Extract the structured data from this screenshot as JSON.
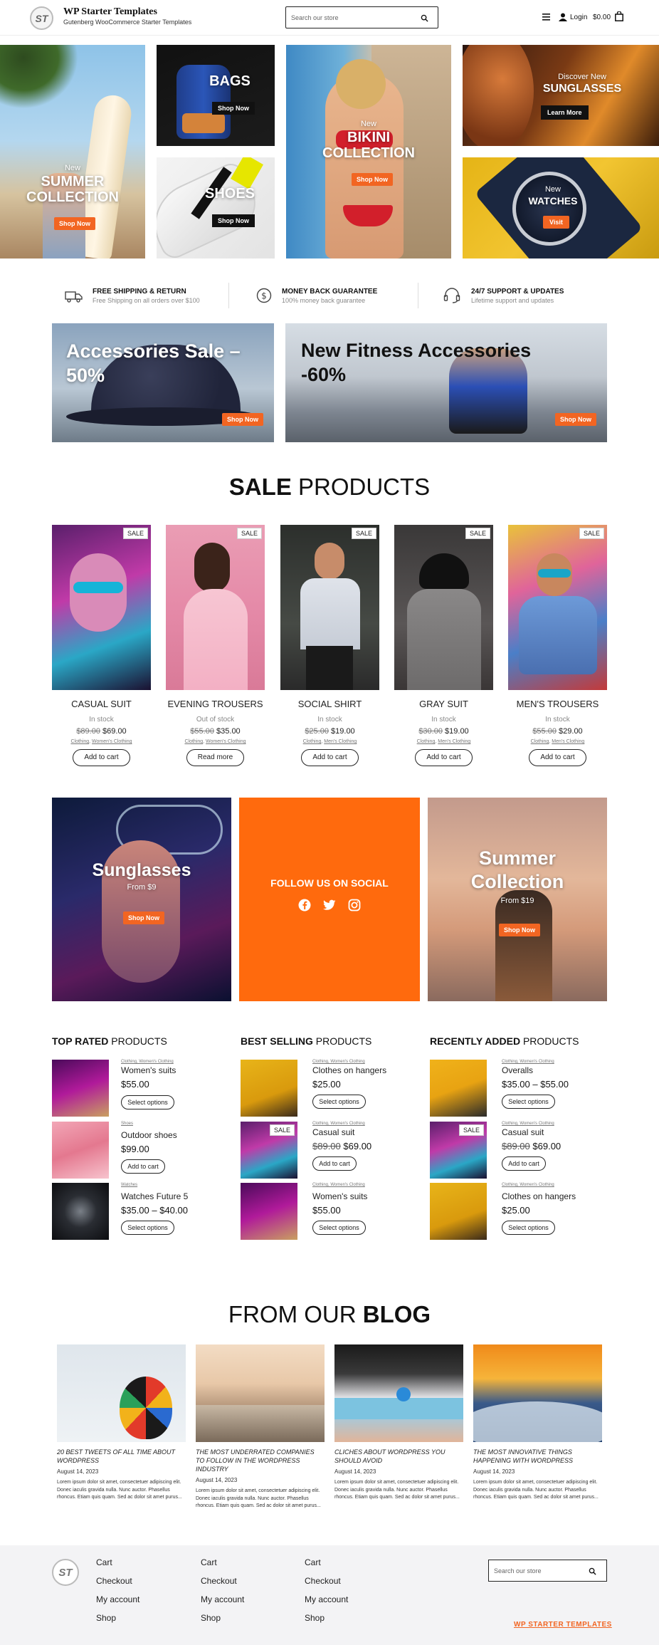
{
  "header": {
    "site_title": "WP Starter Templates",
    "site_tagline": "Gutenberg WooCommerce Starter Templates",
    "logo_text": "ST",
    "search_placeholder": "Search our store",
    "login_label": "Login",
    "cart_total": "$0.00"
  },
  "hero": {
    "summer": {
      "kicker": "New",
      "title1": "SUMMER",
      "title2": "COLLECTION",
      "cta": "Shop Now"
    },
    "bags": {
      "title": "BAGS",
      "cta": "Shop Now"
    },
    "shoes": {
      "title": "SHOES",
      "cta": "Shop Now"
    },
    "bikini": {
      "kicker": "New",
      "title1": "BIKINI",
      "title2": "COLLECTION",
      "cta": "Shop Now"
    },
    "sunglasses": {
      "kicker": "Discover New",
      "title": "SUNGLASSES",
      "cta": "Learn More"
    },
    "watches": {
      "kicker": "New",
      "title": "WATCHES",
      "cta": "Visit"
    }
  },
  "features": [
    {
      "title": "FREE SHIPPING & RETURN",
      "subtitle": "Free Shipping on all orders over $100",
      "icon": "truck-icon"
    },
    {
      "title": "MONEY BACK GUARANTEE",
      "subtitle": "100% money back guarantee",
      "icon": "dollar-icon"
    },
    {
      "title": "24/7 SUPPORT & UPDATES",
      "subtitle": "Lifetime support and updates",
      "icon": "support-icon"
    }
  ],
  "promo": {
    "accessories": {
      "title1": "Accessories Sale –",
      "title2": "50%",
      "cta": "Shop Now"
    },
    "fitness": {
      "title1": "New Fitness Accessories",
      "title2": "-60%",
      "cta": "Shop Now"
    }
  },
  "sale_section": {
    "title_bold": "SALE",
    "title_light": "PRODUCTS",
    "badge": "SALE",
    "products": [
      {
        "name": "CASUAL SUIT",
        "stock": "In stock",
        "old_price": "$89.00",
        "price": "$69.00",
        "cat1": "Clothing",
        "cat2": "Women's Clothing",
        "action": "Add to cart"
      },
      {
        "name": "EVENING TROUSERS",
        "stock": "Out of stock",
        "old_price": "$55.00",
        "price": "$35.00",
        "cat1": "Clothing",
        "cat2": "Women's Clothing",
        "action": "Read more"
      },
      {
        "name": "SOCIAL SHIRT",
        "stock": "In stock",
        "old_price": "$25.00",
        "price": "$19.00",
        "cat1": "Clothing",
        "cat2": "Men's Clothing",
        "action": "Add to cart"
      },
      {
        "name": "GRAY SUIT",
        "stock": "In stock",
        "old_price": "$30.00",
        "price": "$19.00",
        "cat1": "Clothing",
        "cat2": "Men's Clothing",
        "action": "Add to cart"
      },
      {
        "name": "MEN'S TROUSERS",
        "stock": "In stock",
        "old_price": "$55.00",
        "price": "$29.00",
        "cat1": "Clothing",
        "cat2": "Men's Clothing",
        "action": "Add to cart"
      }
    ]
  },
  "banners": {
    "sunglasses": {
      "title": "Sunglasses",
      "subtitle": "From $9",
      "cta": "Shop Now"
    },
    "social": {
      "title": "FOLLOW US ON SOCIAL"
    },
    "summer": {
      "title1": "Summer",
      "title2": "Collection",
      "subtitle": "From $19",
      "cta": "Shop Now"
    }
  },
  "product_lists": [
    {
      "title_bold": "TOP RATED",
      "title_light": "PRODUCTS",
      "items": [
        {
          "cats": "Clothing, Women's Clothing",
          "name": "Women's suits",
          "price": "$55.00",
          "old_price": "",
          "action": "Select options",
          "sale": false
        },
        {
          "cats": "Shoes",
          "name": "Outdoor shoes",
          "price": "$99.00",
          "old_price": "",
          "action": "Add to cart",
          "sale": false
        },
        {
          "cats": "Watches",
          "name": "Watches Future 5",
          "price": "$35.00 – $40.00",
          "old_price": "",
          "action": "Select options",
          "sale": false
        }
      ]
    },
    {
      "title_bold": "BEST SELLING",
      "title_light": "PRODUCTS",
      "items": [
        {
          "cats": "Clothing, Women's Clothing",
          "name": "Clothes on hangers",
          "price": "$25.00",
          "old_price": "",
          "action": "Select options",
          "sale": false
        },
        {
          "cats": "Clothing, Women's Clothing",
          "name": "Casual suit",
          "price": "$69.00",
          "old_price": "$89.00",
          "action": "Add to cart",
          "sale": true
        },
        {
          "cats": "Clothing, Women's Clothing",
          "name": "Women's suits",
          "price": "$55.00",
          "old_price": "",
          "action": "Select options",
          "sale": false
        }
      ]
    },
    {
      "title_bold": "RECENTLY ADDED",
      "title_light": "PRODUCTS",
      "items": [
        {
          "cats": "Clothing, Women's Clothing",
          "name": "Overalls",
          "price": "$35.00 – $55.00",
          "old_price": "",
          "action": "Select options",
          "sale": false
        },
        {
          "cats": "Clothing, Women's Clothing",
          "name": "Casual suit",
          "price": "$69.00",
          "old_price": "$89.00",
          "action": "Add to cart",
          "sale": true
        },
        {
          "cats": "Clothing, Women's Clothing",
          "name": "Clothes on hangers",
          "price": "$25.00",
          "old_price": "",
          "action": "Select options",
          "sale": false
        }
      ]
    }
  ],
  "blog": {
    "title_light": "FROM OUR",
    "title_bold": "BLOG",
    "posts": [
      {
        "title": "20 BEST TWEETS OF ALL TIME ABOUT WORDPRESS",
        "date": "August 14, 2023",
        "excerpt": "Lorem ipsum dolor sit amet, consectetuer adipiscing elit. Donec iaculis gravida nulla. Nunc auctor. Phasellus rhoncus. Etiam quis quam. Sed ac dolor sit amet purus..."
      },
      {
        "title": "THE MOST UNDERRATED COMPANIES TO FOLLOW IN THE WORDPRESS INDUSTRY",
        "date": "August 14, 2023",
        "excerpt": "Lorem ipsum dolor sit amet, consectetuer adipiscing elit. Donec iaculis gravida nulla. Nunc auctor. Phasellus rhoncus. Etiam quis quam. Sed ac dolor sit amet purus..."
      },
      {
        "title": "CLICHES ABOUT WORDPRESS YOU SHOULD AVOID",
        "date": "August 14, 2023",
        "excerpt": "Lorem ipsum dolor sit amet, consectetuer adipiscing elit. Donec iaculis gravida nulla. Nunc auctor. Phasellus rhoncus. Etiam quis quam. Sed ac dolor sit amet purus..."
      },
      {
        "title": "THE MOST INNOVATIVE THINGS HAPPENING WITH WORDPRESS",
        "date": "August 14, 2023",
        "excerpt": "Lorem ipsum dolor sit amet, consectetuer adipiscing elit. Donec iaculis gravida nulla. Nunc auctor. Phasellus rhoncus. Etiam quis quam. Sed ac dolor sit amet purus..."
      }
    ]
  },
  "footer": {
    "logo_text": "ST",
    "columns": [
      [
        "Cart",
        "Checkout",
        "My account",
        "Shop"
      ],
      [
        "Cart",
        "Checkout",
        "My account",
        "Shop"
      ],
      [
        "Cart",
        "Checkout",
        "My account",
        "Shop"
      ]
    ],
    "search_placeholder": "Search our store",
    "brand_link": "WP STARTER TEMPLATES"
  },
  "colors": {
    "accent": "#f26522",
    "dark": "#111111",
    "footer_bg": "#f3f3f5"
  }
}
